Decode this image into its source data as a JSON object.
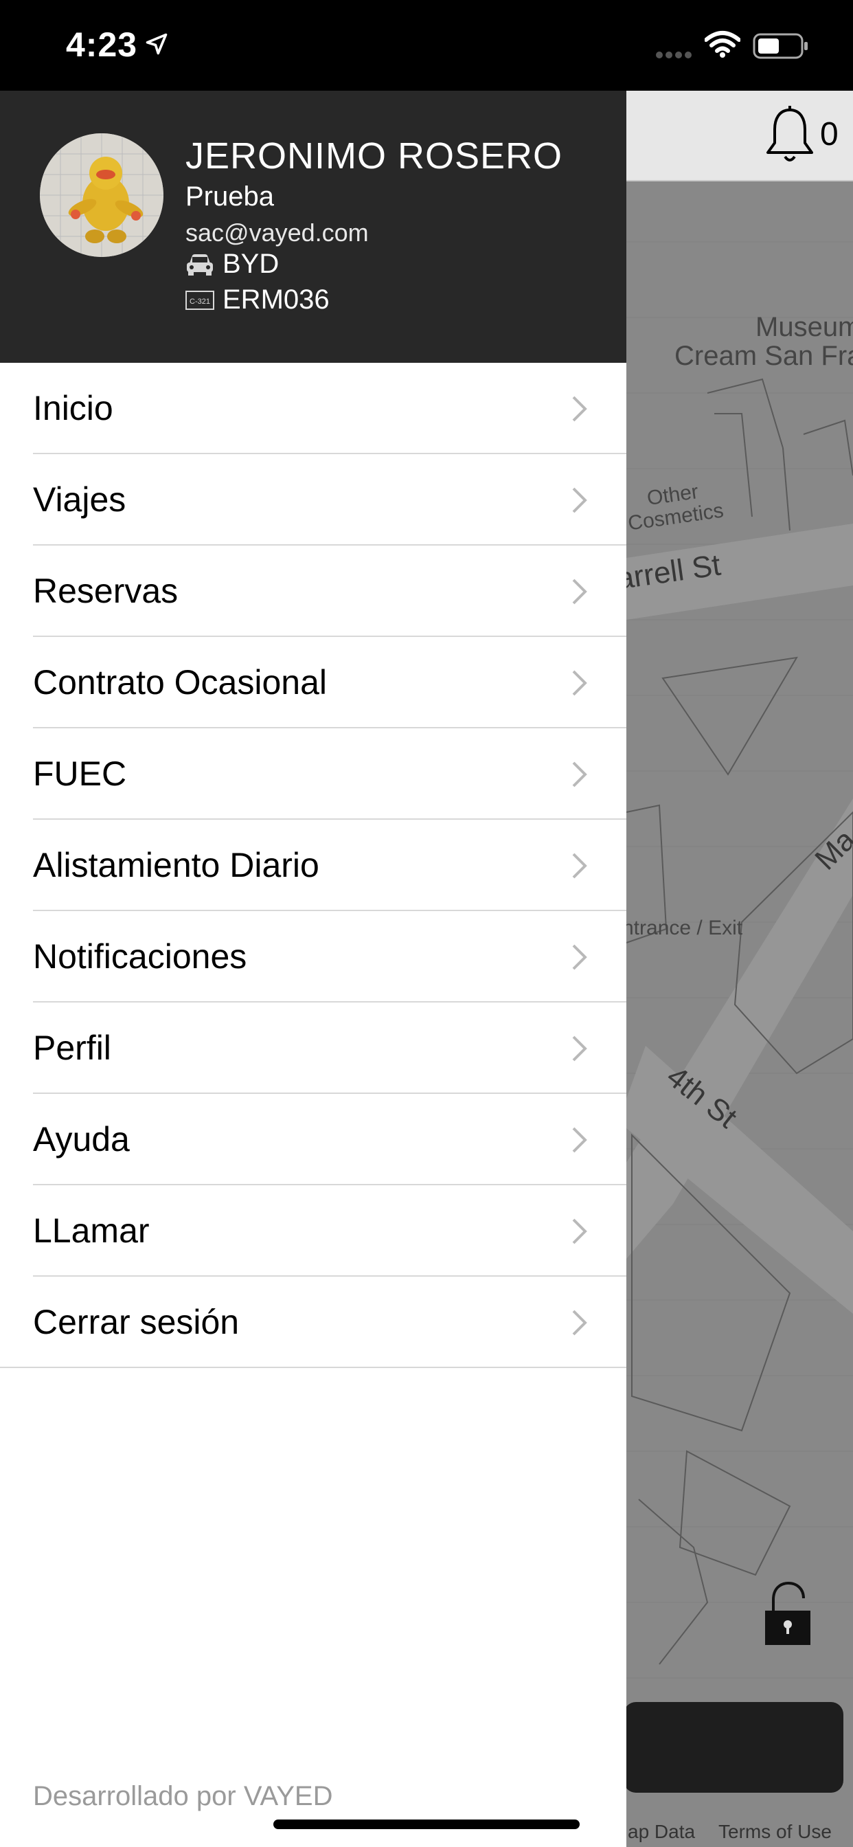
{
  "status_bar": {
    "time": "4:23"
  },
  "map": {
    "notification_count": "0",
    "labels": {
      "museum": "Museum",
      "cream": "Cream San Fra",
      "other": "Other",
      "cosmetics": "Cosmetics",
      "farrell": "arrell St",
      "market": "Ma",
      "entrance": "ntrance / Exit",
      "fourth": "4th St"
    },
    "footer": {
      "map_data": "ap Data",
      "terms": "Terms of Use"
    }
  },
  "drawer": {
    "user": {
      "name": "JERONIMO ROSERO",
      "company": "Prueba",
      "email": "sac@vayed.com",
      "vehicle": "BYD",
      "plate": "ERM036",
      "plate_icon_text": "C-321"
    },
    "menu": [
      {
        "label": "Inicio"
      },
      {
        "label": "Viajes"
      },
      {
        "label": "Reservas"
      },
      {
        "label": "Contrato Ocasional"
      },
      {
        "label": "FUEC"
      },
      {
        "label": "Alistamiento Diario"
      },
      {
        "label": "Notificaciones"
      },
      {
        "label": "Perfil"
      },
      {
        "label": "Ayuda"
      },
      {
        "label": "LLamar"
      },
      {
        "label": "Cerrar sesión"
      }
    ],
    "developer_credit": "Desarrollado por VAYED"
  },
  "colors": {
    "drawer_header_bg": "#282828",
    "separator": "#d8d8d8",
    "chevron": "#b9b9b9",
    "credit_text": "#9a9a9a"
  }
}
